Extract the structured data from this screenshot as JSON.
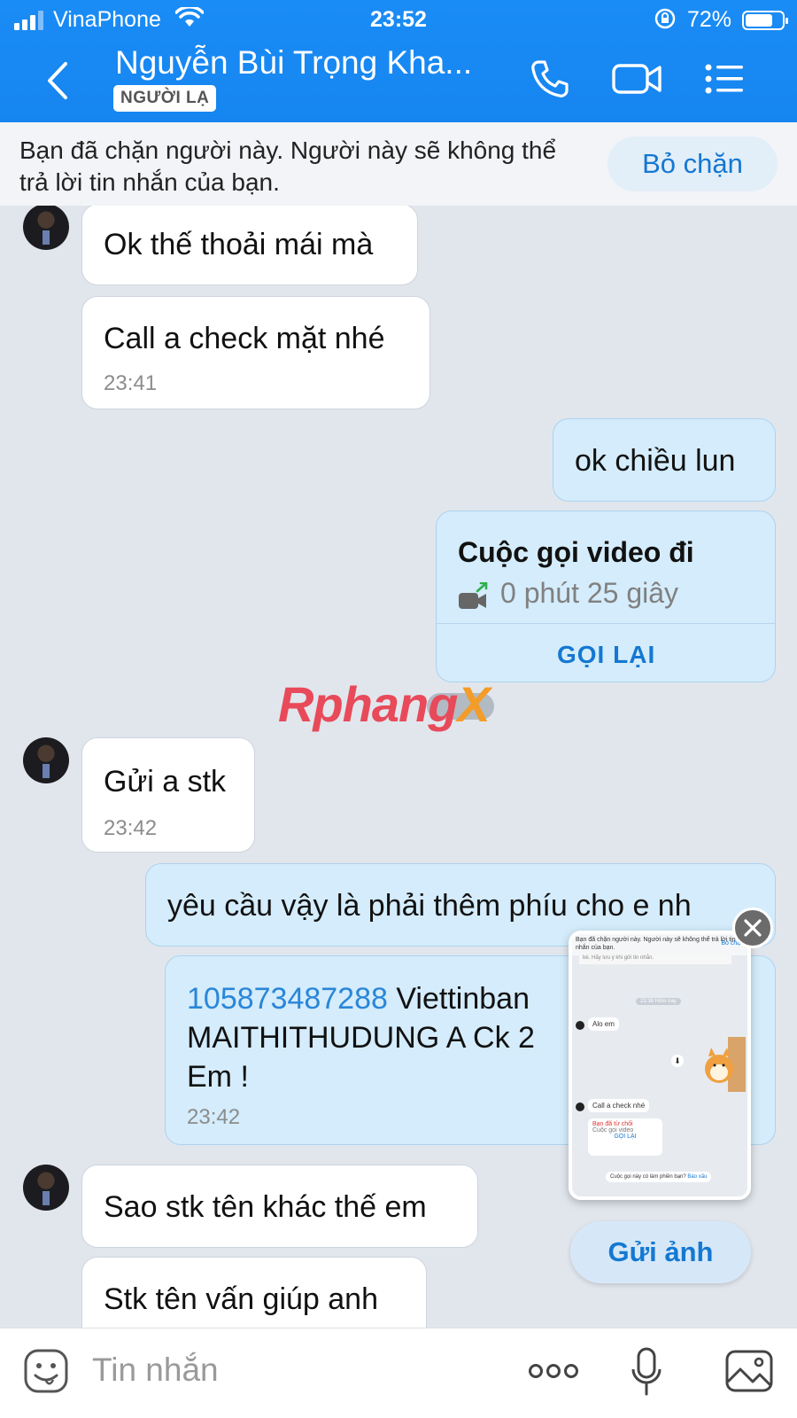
{
  "status_bar": {
    "carrier": "VinaPhone",
    "time": "23:52",
    "battery": "72%"
  },
  "header": {
    "name": "Nguyễn Bùi Trọng Kha...",
    "badge": "NGƯỜI LẠ"
  },
  "banner": {
    "text": "Bạn đã chặn người này. Người này sẽ không thể trả lời tin nhắn của bạn.",
    "unblock_label": "Bỏ chặn"
  },
  "messages": {
    "m1": "Ok thế thoải mái mà",
    "m2": "Call a check mặt nhé",
    "m2_time": "23:41",
    "m3": "ok chiều lun",
    "call_title": "Cuộc gọi video đi",
    "call_duration": "0 phút 25 giây",
    "call_again": "GỌI LẠI",
    "m4": "Gửi a stk",
    "m4_time": "23:42",
    "m5": "yêu cầu vậy là phải thêm phíu cho e nh",
    "m6_account": "105873487288",
    "m6_line1_rest": " Viettinban",
    "m6_line2": "MAITHITHUDUNG  A Ck 2",
    "m6_line3": "Em !",
    "m6_time": "23:42",
    "m7": "Sao stk tên khác thế em",
    "m8": "Stk tên vấn giúp anh"
  },
  "watermark": {
    "main": "Rphang",
    "x": "X"
  },
  "thumbnail": {
    "banner": "Bạn đã chặn người này. Người này sẽ không thể trả lời tin nhắn của bạn.",
    "unblock": "Bỏ chặn",
    "note": "bè. Hãy lưu ý khi gửi tin nhắn.",
    "date": "23:38 Hôm nay",
    "alo": "Alo em",
    "check": "Call a check nhé",
    "declined": "Bạn đã từ chối",
    "video_call": "Cuộc gọi video",
    "call_again": "GỌI LẠI",
    "annoy": "Cuộc gọi này có làm phiền bạn?",
    "report": "Báo xấu"
  },
  "send_photo": "Gửi ảnh",
  "composer": {
    "placeholder": "Tin nhắn"
  },
  "colors": {
    "header": "#1685f0",
    "accent": "#1478d2",
    "outgoing": "#d4ecfb"
  }
}
